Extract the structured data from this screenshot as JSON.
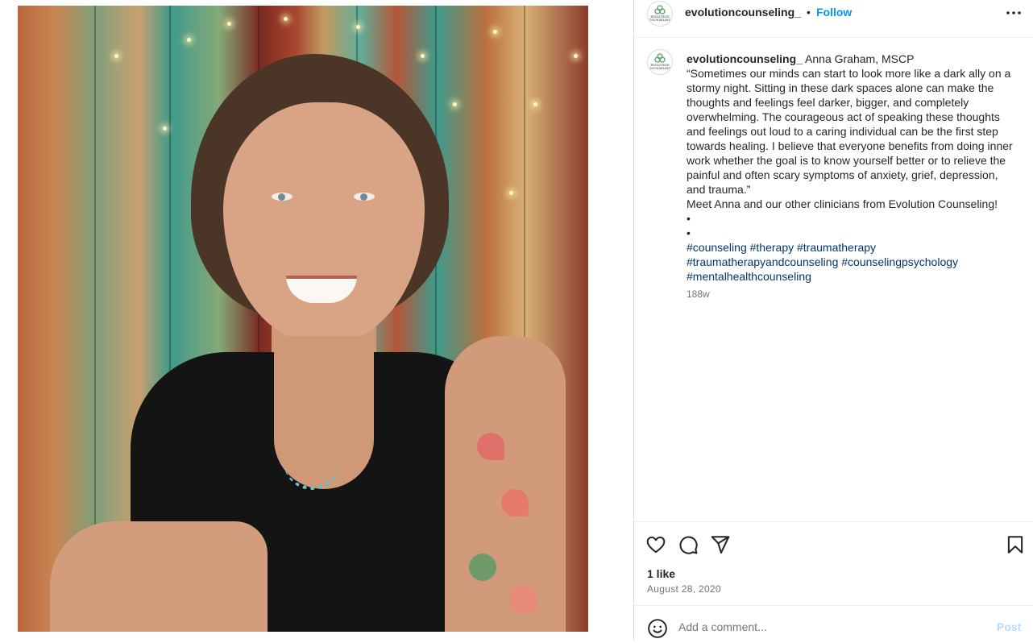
{
  "post": {
    "image_alt": "Smiling woman with short brown hair in a black sleeveless top with a floral arm tattoo, in front of a colorful weathered wooden wall with string lights"
  },
  "header": {
    "username": "evolutioncounseling_",
    "separator": "•",
    "follow_label": "Follow",
    "avatar_text_1": "EVOLUTION",
    "avatar_text_2": "COUNSELING"
  },
  "caption": {
    "username": "evolutioncounseling_",
    "lines": [
      "Anna Graham, MSCP",
      "“Sometimes our minds can start to look more like a dark ally on a stormy night. Sitting in these dark spaces alone can make the thoughts and feelings feel darker, bigger, and completely overwhelming. The courageous act of speaking these thoughts and feelings out loud to a caring individual can be the first step towards healing. I believe that everyone benefits from doing inner work whether the goal is to know yourself better or to relieve the painful and often scary symptoms of anxiety, grief, depression, and trauma.”",
      "Meet Anna and our other clinicians from Evolution Counseling!",
      "•",
      "•"
    ],
    "hashtags": [
      "#counseling",
      "#therapy",
      "#traumatherapy",
      "#traumatherapyandcounseling",
      "#counselingpsychology",
      "#mentalhealthcounseling"
    ],
    "age": "188w"
  },
  "actions": {
    "likes": "1 like",
    "date": "August 28, 2020",
    "icons": [
      "heart-icon",
      "comment-icon",
      "share-icon",
      "bookmark-icon"
    ]
  },
  "comment": {
    "placeholder": "Add a comment...",
    "post_label": "Post"
  },
  "colors": {
    "link": "#0095f6",
    "hashtag": "#00376b",
    "muted": "#737373",
    "post_disabled": "#b3dbff"
  }
}
